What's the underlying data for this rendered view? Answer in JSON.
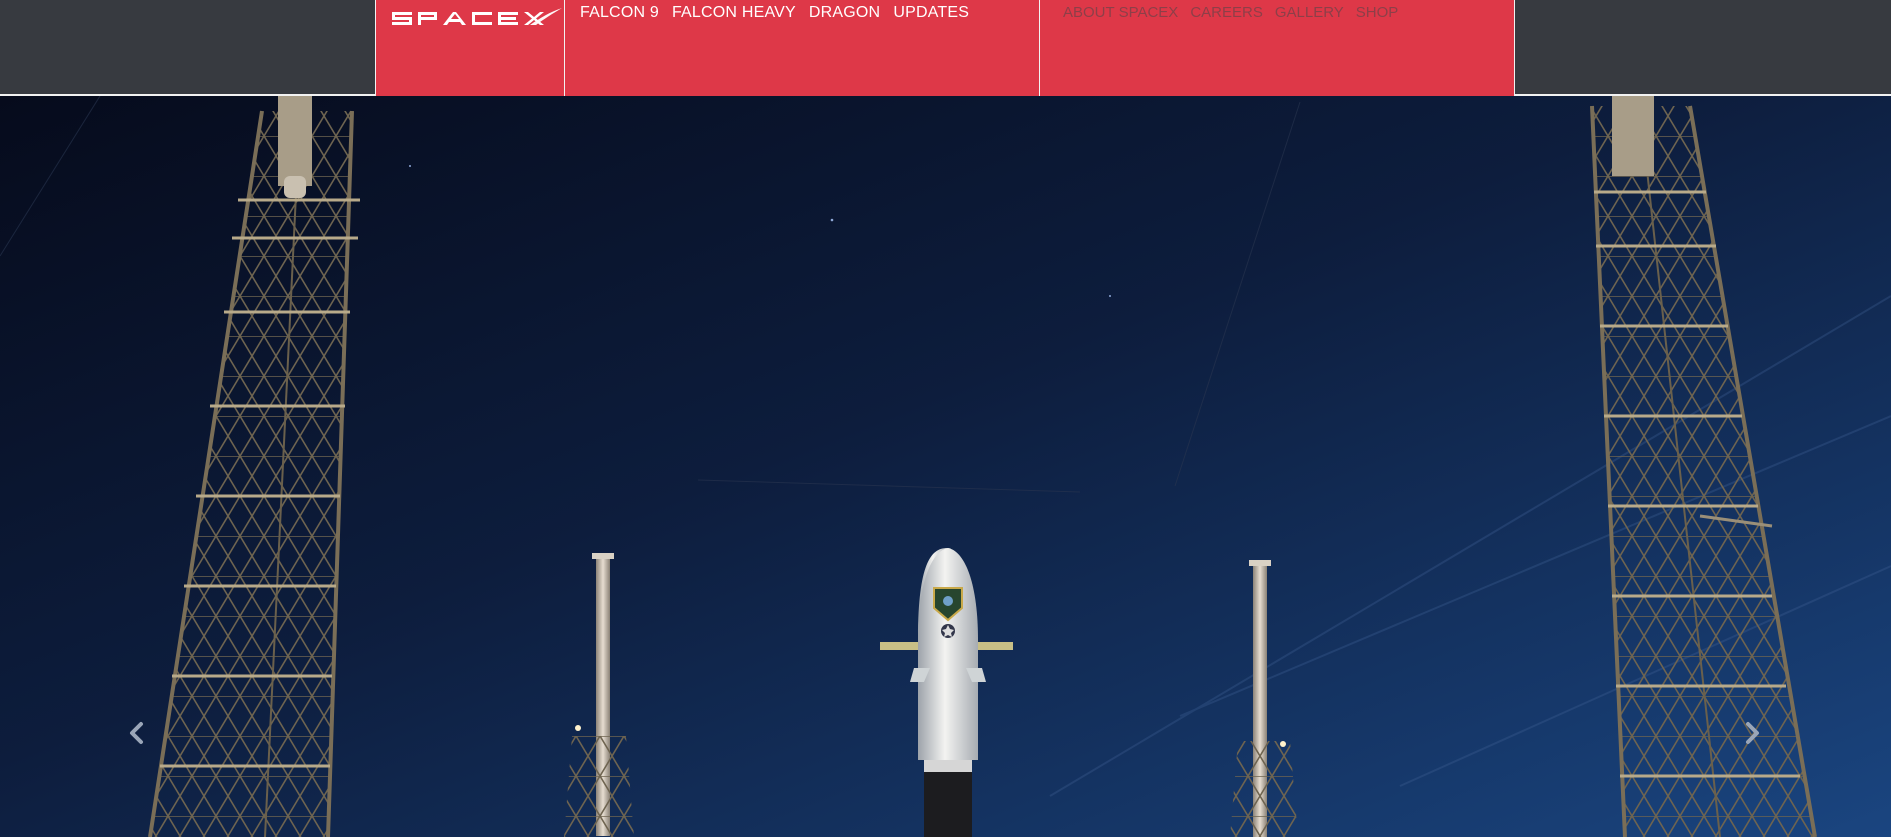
{
  "header": {
    "logo_icon": "spacex-logo",
    "nav_primary": [
      "FALCON 9",
      "FALCON HEAVY",
      "DRAGON",
      "UPDATES"
    ],
    "nav_secondary": [
      "ABOUT SPACEX",
      "CAREERS",
      "GALLERY",
      "SHOP"
    ]
  },
  "hero": {
    "image": "rocket-launch-pad-night",
    "prev_icon": "chevron-left-icon",
    "next_icon": "chevron-right-icon"
  },
  "colors": {
    "header_bg": "#373a40",
    "accent": "#de3848",
    "nav_text": "#ffffff",
    "nav_secondary_text": "#8d3f48",
    "sky_dark": "#0a1226",
    "sky_light": "#173a6e"
  }
}
